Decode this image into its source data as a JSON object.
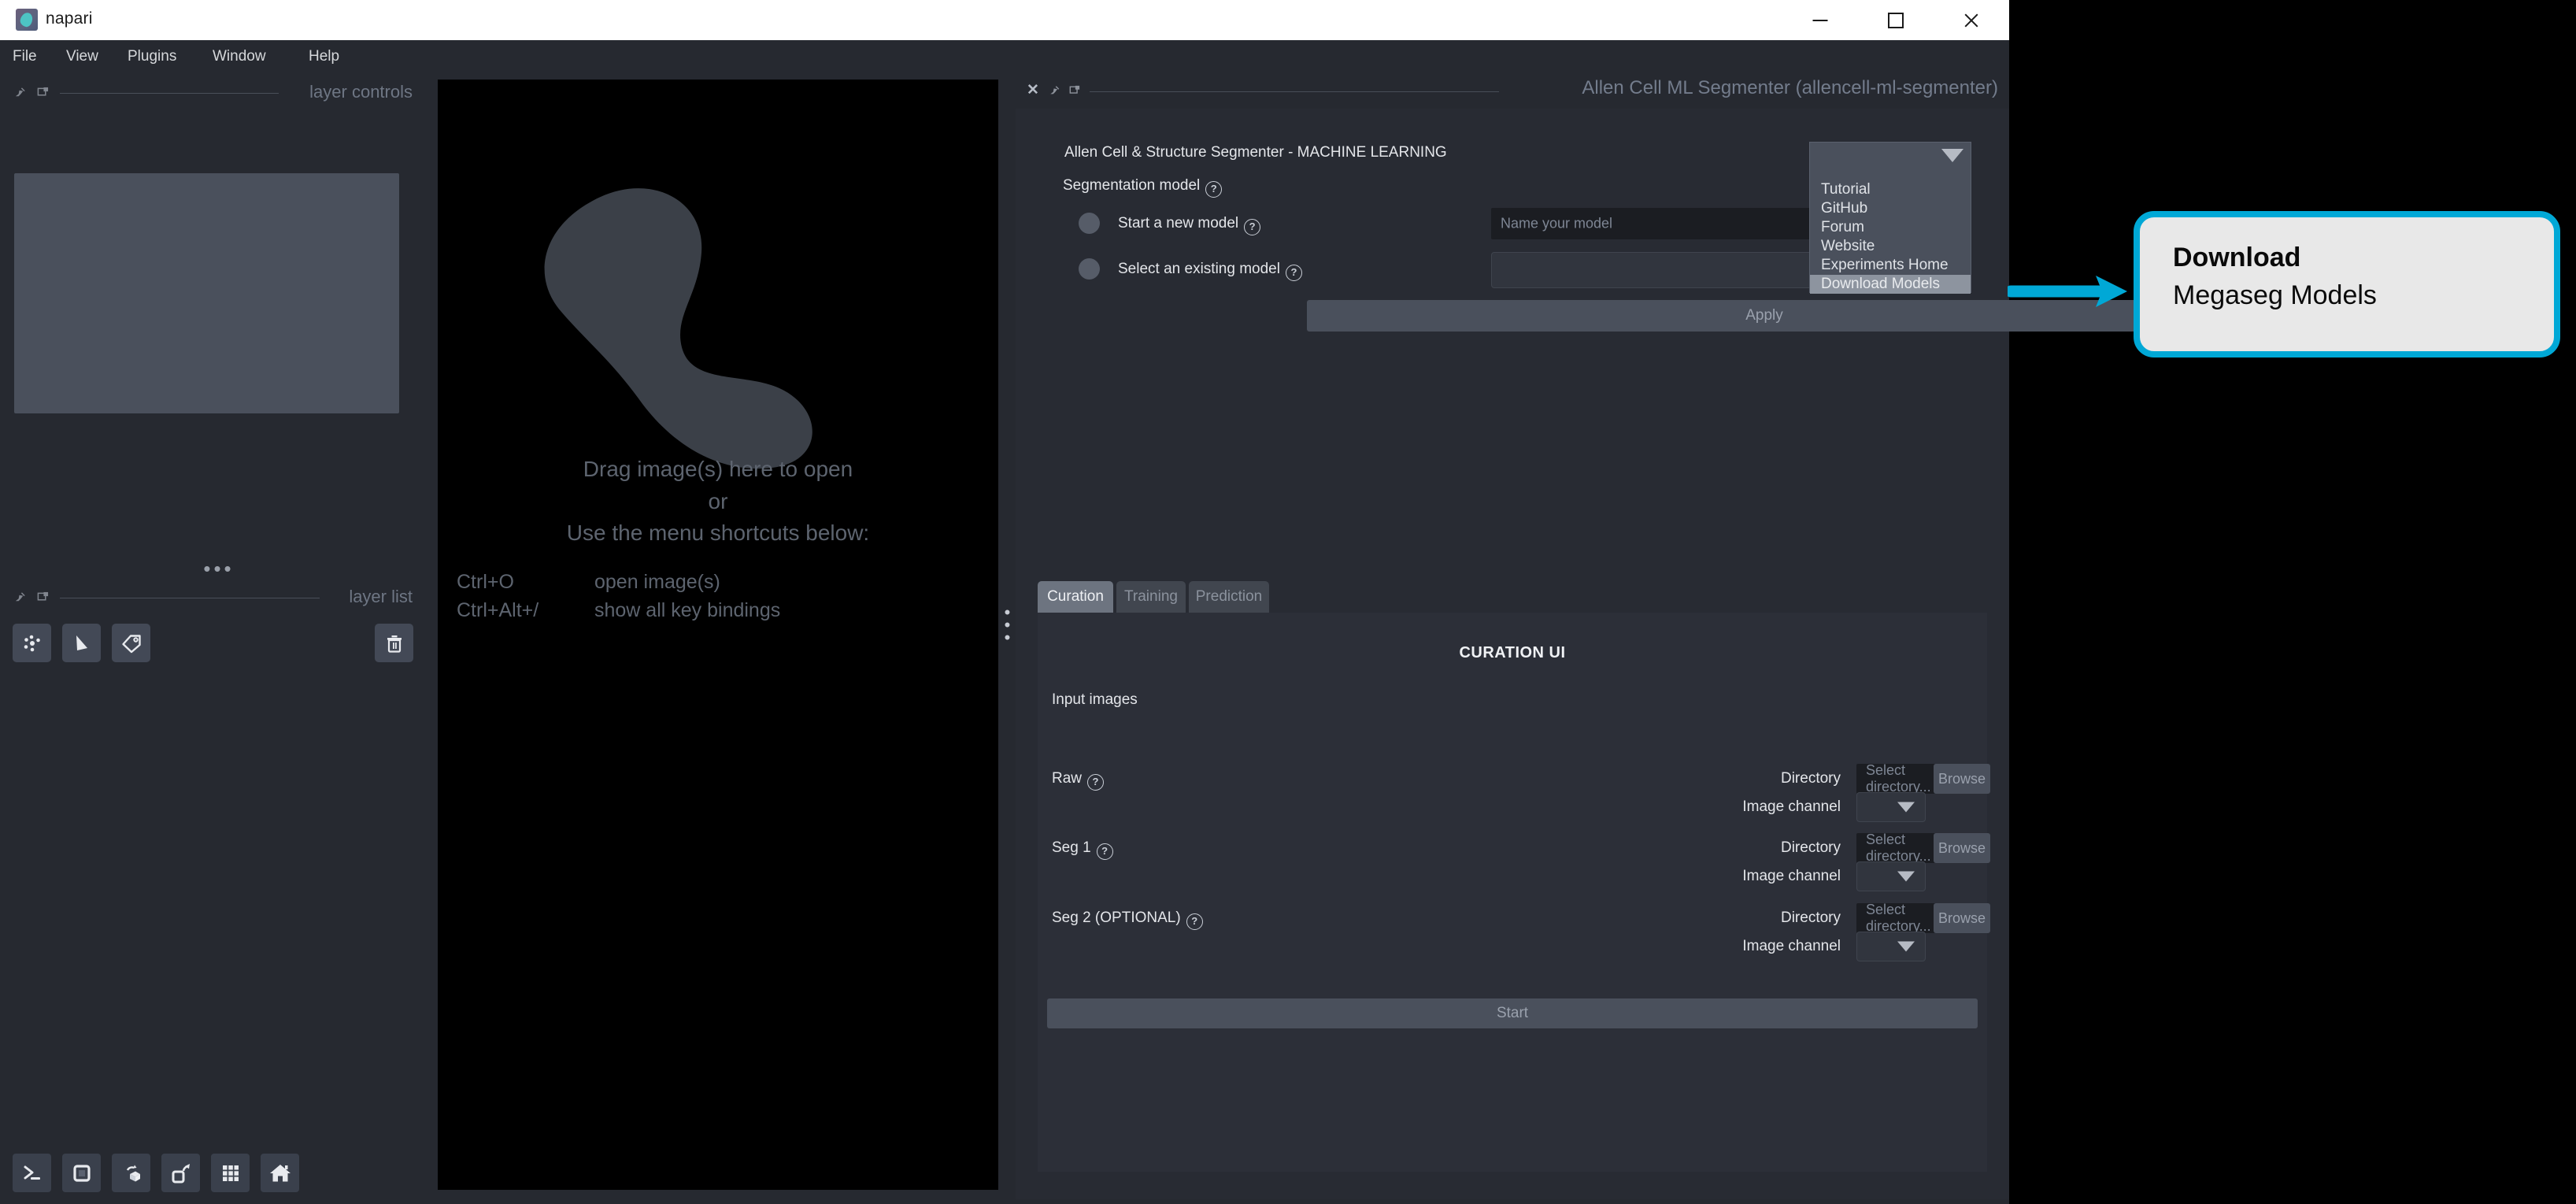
{
  "window": {
    "title": "napari",
    "icon": "napari-logo-icon",
    "controls": {
      "minimize": "minimize-icon",
      "maximize": "maximize-icon",
      "close": "close-icon"
    }
  },
  "menubar": {
    "items": [
      "File",
      "View",
      "Plugins",
      "Window",
      "Help"
    ]
  },
  "left_dock": {
    "layer_controls": {
      "label": "layer controls",
      "icons": [
        "pin-icon",
        "float-icon"
      ]
    },
    "layer_list": {
      "label": "layer list",
      "icons": [
        "pin-icon",
        "float-icon"
      ],
      "buttons": [
        "new-points-layer-icon",
        "new-shapes-layer-icon",
        "new-labels-layer-icon"
      ],
      "delete_button": "trash-icon"
    },
    "viewer_buttons": [
      "console-icon",
      "ndisplay-toggle-icon",
      "roll-dims-icon",
      "transpose-dims-icon",
      "grid-view-icon",
      "home-icon"
    ]
  },
  "canvas": {
    "drop_line1": "Drag image(s) here to open",
    "drop_line2": "or",
    "drop_line3": "Use the menu shortcuts below:",
    "shortcuts": [
      {
        "keys": "Ctrl+O",
        "action": "open image(s)"
      },
      {
        "keys": "Ctrl+Alt+/",
        "action": "show all key bindings"
      }
    ]
  },
  "plugin_dock": {
    "header": {
      "title": "Allen Cell ML Segmenter (allencell-ml-segmenter)",
      "icons": [
        "close-icon",
        "float-icon",
        "popout-icon"
      ]
    },
    "heading": "Allen Cell & Structure Segmenter - MACHINE LEARNING",
    "segmentation_model_label": "Segmentation model",
    "help_icon": "help-icon",
    "options": [
      {
        "label": "Start a new model",
        "help": "help-icon",
        "selected": false
      },
      {
        "label": "Select an existing model",
        "help": "help-icon",
        "selected": false
      }
    ],
    "model_name_placeholder": "Name your model",
    "existing_model_value": "",
    "apply_label": "Apply",
    "menu_popup": {
      "collapse_icon": "chevron-down-icon",
      "items": [
        "Tutorial",
        "GitHub",
        "Forum",
        "Website",
        "Experiments Home",
        "Download Models"
      ],
      "highlighted": "Download Models"
    },
    "tabs": [
      {
        "label": "Curation",
        "active": true
      },
      {
        "label": "Training",
        "active": false
      },
      {
        "label": "Prediction",
        "active": false
      }
    ],
    "curation": {
      "title": "CURATION UI",
      "section_label": "Input images",
      "rows": [
        {
          "name": "Raw",
          "help": "help-icon",
          "directory_label": "Directory",
          "directory_placeholder": "Select directory...",
          "browse_label": "Browse",
          "channel_label": "Image channel",
          "channel_value": ""
        },
        {
          "name": "Seg 1",
          "help": "help-icon",
          "directory_label": "Directory",
          "directory_placeholder": "Select directory...",
          "browse_label": "Browse",
          "channel_label": "Image channel",
          "channel_value": ""
        },
        {
          "name": "Seg 2 (OPTIONAL)",
          "help": "help-icon",
          "directory_label": "Directory",
          "directory_placeholder": "Select directory...",
          "browse_label": "Browse",
          "channel_label": "Image channel",
          "channel_value": ""
        }
      ],
      "start_label": "Start"
    }
  },
  "annotation": {
    "arrow": "right-arrow-icon",
    "accent_color": "#00a8d6",
    "line1": "Download",
    "line2": "Megaseg Models"
  }
}
